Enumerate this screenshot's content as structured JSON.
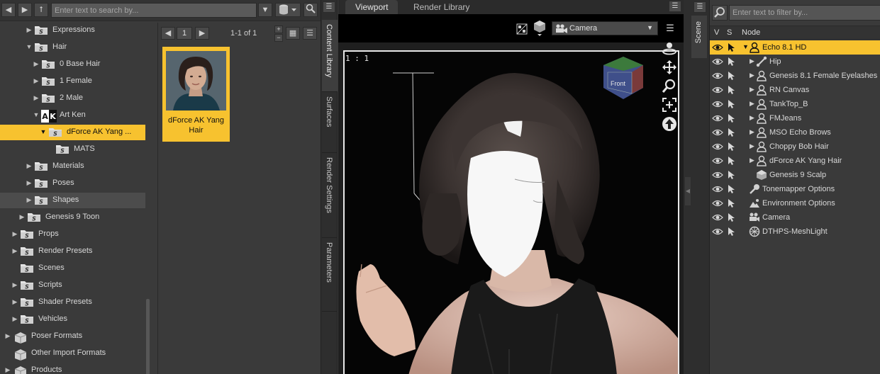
{
  "content_library": {
    "search_placeholder": "Enter text to search by...",
    "tree": [
      {
        "label": "Expressions",
        "arrow": "▶",
        "indent": 3
      },
      {
        "label": "Hair",
        "arrow": "▼",
        "indent": 3
      },
      {
        "label": "0 Base Hair",
        "arrow": "▶",
        "indent": 4
      },
      {
        "label": "1 Female",
        "arrow": "▶",
        "indent": 4
      },
      {
        "label": "2 Male",
        "arrow": "▶",
        "indent": 4
      },
      {
        "label": "Art Ken",
        "arrow": "▼",
        "indent": 4,
        "badge": "AK"
      },
      {
        "label": "dForce AK Yang ...",
        "arrow": "▼",
        "indent": 5,
        "selected": true
      },
      {
        "label": "MATS",
        "arrow": "",
        "indent": 6
      },
      {
        "label": "Materials",
        "arrow": "▶",
        "indent": 3
      },
      {
        "label": "Poses",
        "arrow": "▶",
        "indent": 3
      },
      {
        "label": "Shapes",
        "arrow": "▶",
        "indent": 3,
        "highlight": true
      },
      {
        "label": "Genesis 9 Toon",
        "arrow": "▶",
        "indent": 2
      },
      {
        "label": "Props",
        "arrow": "▶",
        "indent": 1
      },
      {
        "label": "Render Presets",
        "arrow": "▶",
        "indent": 1
      },
      {
        "label": "Scenes",
        "arrow": "",
        "indent": 1
      },
      {
        "label": "Scripts",
        "arrow": "▶",
        "indent": 1
      },
      {
        "label": "Shader Presets",
        "arrow": "▶",
        "indent": 1
      },
      {
        "label": "Vehicles",
        "arrow": "▶",
        "indent": 1
      },
      {
        "label": "Poser Formats",
        "arrow": "▶",
        "indent": 0,
        "box": true
      },
      {
        "label": "Other Import Formats",
        "arrow": "",
        "indent": 0,
        "box": true
      },
      {
        "label": "Products",
        "arrow": "▶",
        "indent": 0,
        "box": true
      }
    ],
    "page": {
      "current": "1",
      "count": "1-1 of 1"
    },
    "thumbnail": {
      "title": "dForce AK Yang Hair"
    }
  },
  "side_tabs": [
    "Content Library",
    "Surfaces",
    "Render Settings",
    "Parameters"
  ],
  "viewport": {
    "tabs": [
      "Viewport",
      "Render Library"
    ],
    "camera": "Camera",
    "ratio": "1 : 1",
    "cube_label": "Front"
  },
  "scene": {
    "tab": "Scene",
    "filter_placeholder": "Enter text to filter by...",
    "columns": {
      "v": "V",
      "s": "S",
      "node": "Node"
    },
    "nodes": [
      {
        "label": "Echo 8.1 HD",
        "expand": "▼",
        "icon": "figure",
        "selected": true,
        "indent": 0
      },
      {
        "label": "Hip",
        "expand": "▶",
        "icon": "bone",
        "indent": 1
      },
      {
        "label": "Genesis 8.1 Female Eyelashes",
        "expand": "▶",
        "icon": "figure",
        "indent": 1
      },
      {
        "label": "RN Canvas",
        "expand": "▶",
        "icon": "figure",
        "indent": 1
      },
      {
        "label": "TankTop_B",
        "expand": "▶",
        "icon": "figure",
        "indent": 1
      },
      {
        "label": "FMJeans",
        "expand": "▶",
        "icon": "figure",
        "indent": 1
      },
      {
        "label": "MSO Echo Brows",
        "expand": "▶",
        "icon": "figure",
        "indent": 1
      },
      {
        "label": "Choppy Bob Hair",
        "expand": "▶",
        "icon": "figure",
        "indent": 1
      },
      {
        "label": "dForce AK Yang Hair",
        "expand": "▶",
        "icon": "figure",
        "indent": 1
      },
      {
        "label": "Genesis 9 Scalp",
        "expand": "",
        "icon": "prop",
        "indent": 1
      },
      {
        "label": "Tonemapper Options",
        "expand": "",
        "icon": "tone",
        "indent": 0
      },
      {
        "label": "Environment Options",
        "expand": "",
        "icon": "env",
        "indent": 0
      },
      {
        "label": "Camera",
        "expand": "",
        "icon": "camera",
        "indent": 0
      },
      {
        "label": "DTHPS-MeshLight",
        "expand": "",
        "icon": "light",
        "indent": 0
      }
    ]
  },
  "colors": {
    "accent": "#f7c22f"
  }
}
